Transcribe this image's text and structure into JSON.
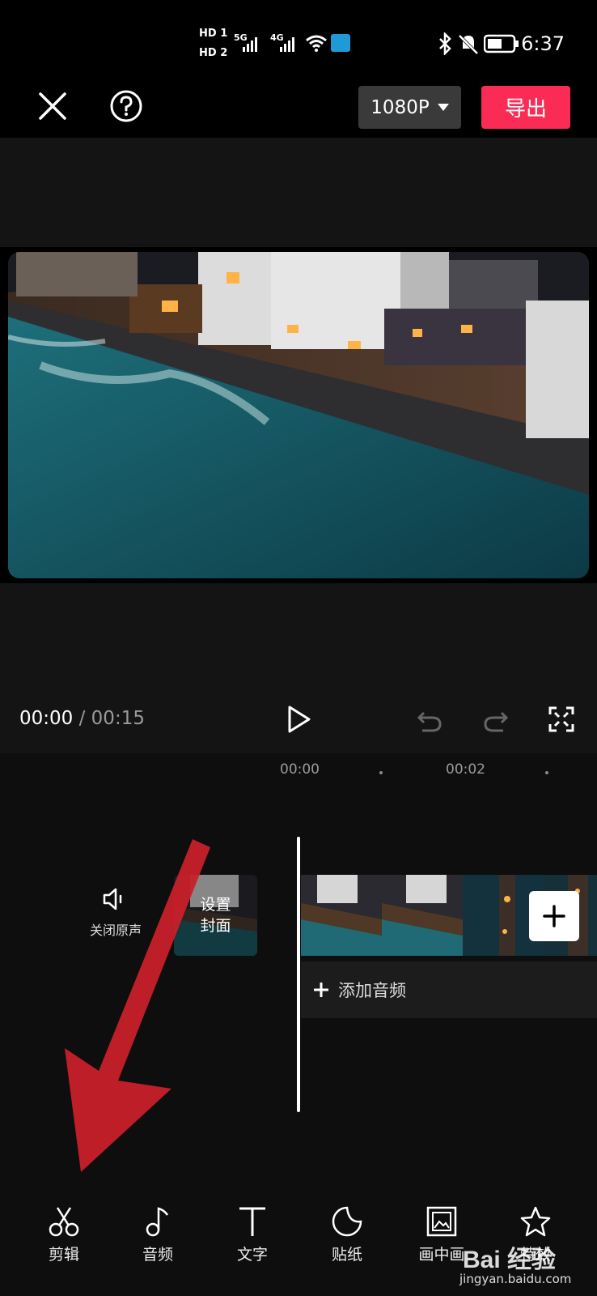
{
  "status_bar": {
    "sim1": "HD 1",
    "sim2": "HD 2",
    "net1": "5G",
    "net2": "4G",
    "time": "6:37"
  },
  "top_bar": {
    "resolution": "1080P",
    "export_label": "导出"
  },
  "player": {
    "current_time": "00:00",
    "separator": " / ",
    "total_time": "00:15"
  },
  "timeline": {
    "ruler_ticks": [
      "00:00",
      "00:02"
    ],
    "mute_label": "关闭原声",
    "cover_label_line1": "设置",
    "cover_label_line2": "封面",
    "add_audio_label": "添加音频"
  },
  "toolbar": {
    "items": [
      {
        "label": "剪辑",
        "icon": "scissors-icon"
      },
      {
        "label": "音频",
        "icon": "music-note-icon"
      },
      {
        "label": "文字",
        "icon": "text-icon"
      },
      {
        "label": "贴纸",
        "icon": "sticker-icon"
      },
      {
        "label": "画中画",
        "icon": "picture-in-picture-icon"
      },
      {
        "label": "特效",
        "icon": "effects-star-icon"
      }
    ]
  },
  "watermark": {
    "logo": "Bai 经验",
    "url": "jingyan.baidu.com"
  },
  "colors": {
    "export_button": "#fa2c55",
    "background": "#000000",
    "annotation_arrow": "#c8202a"
  }
}
